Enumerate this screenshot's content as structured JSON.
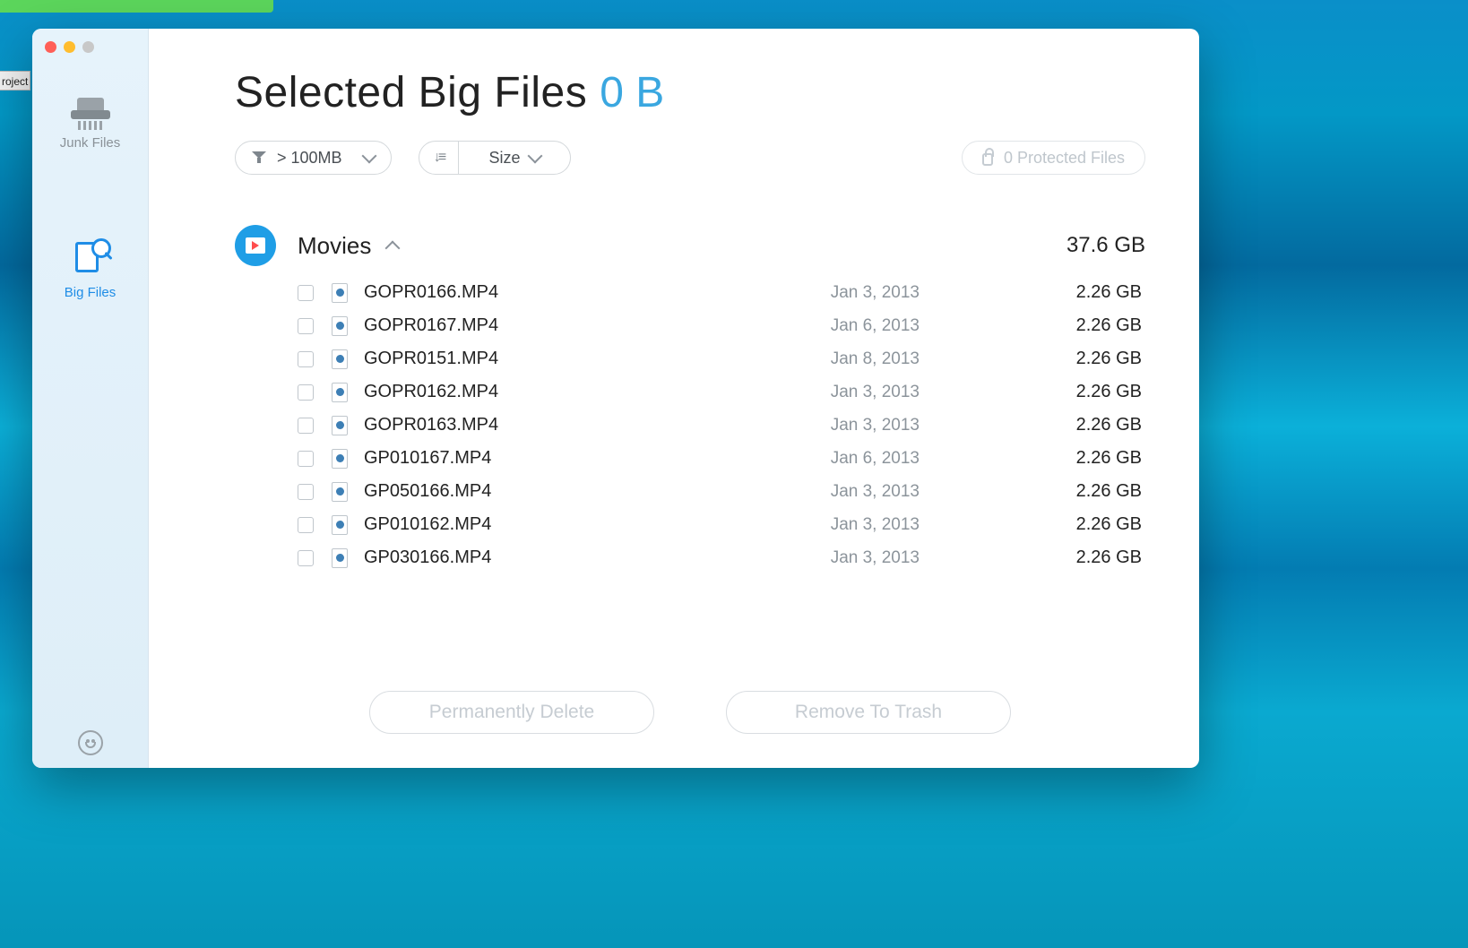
{
  "sidebar": {
    "items": [
      {
        "label": "Junk Files"
      },
      {
        "label": "Big Files"
      }
    ]
  },
  "header": {
    "title": "Selected Big Files",
    "selected_size": "0 B"
  },
  "filters": {
    "size_filter": "> 100MB",
    "sort_by": "Size",
    "protected": "0 Protected Files"
  },
  "category": {
    "name": "Movies",
    "total_size": "37.6 GB",
    "files": [
      {
        "name": "GOPR0166.MP4",
        "date": "Jan 3, 2013",
        "size": "2.26 GB"
      },
      {
        "name": "GOPR0167.MP4",
        "date": "Jan 6, 2013",
        "size": "2.26 GB"
      },
      {
        "name": "GOPR0151.MP4",
        "date": "Jan 8, 2013",
        "size": "2.26 GB"
      },
      {
        "name": "GOPR0162.MP4",
        "date": "Jan 3, 2013",
        "size": "2.26 GB"
      },
      {
        "name": "GOPR0163.MP4",
        "date": "Jan 3, 2013",
        "size": "2.26 GB"
      },
      {
        "name": "GP010167.MP4",
        "date": "Jan 6, 2013",
        "size": "2.26 GB"
      },
      {
        "name": "GP050166.MP4",
        "date": "Jan 3, 2013",
        "size": "2.26 GB"
      },
      {
        "name": "GP010162.MP4",
        "date": "Jan 3, 2013",
        "size": "2.26 GB"
      },
      {
        "name": "GP030166.MP4",
        "date": "Jan 3, 2013",
        "size": "2.26 GB"
      }
    ]
  },
  "actions": {
    "delete": "Permanently Delete",
    "trash": "Remove To Trash"
  },
  "bg": {
    "tab": "roject"
  }
}
